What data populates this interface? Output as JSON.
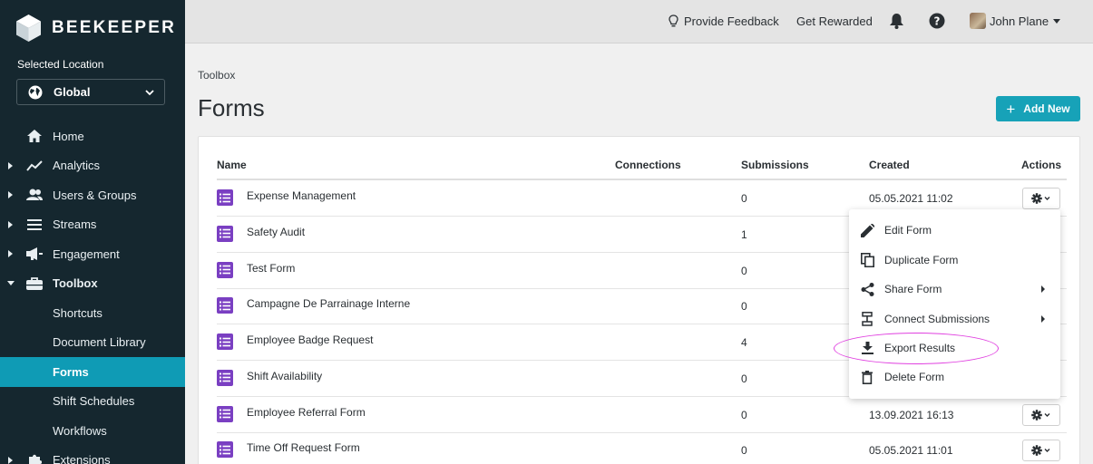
{
  "brand": {
    "name": "BEEKEEPER"
  },
  "location": {
    "label": "Selected Location",
    "value": "Global"
  },
  "nav": [
    {
      "label": "Home",
      "icon": "home-icon",
      "caret": false,
      "sub": false,
      "active": false
    },
    {
      "label": "Analytics",
      "icon": "analytics-icon",
      "caret": true,
      "sub": false,
      "active": false
    },
    {
      "label": "Users & Groups",
      "icon": "users-icon",
      "caret": true,
      "sub": false,
      "active": false
    },
    {
      "label": "Streams",
      "icon": "streams-icon",
      "caret": true,
      "sub": false,
      "active": false
    },
    {
      "label": "Engagement",
      "icon": "megaphone-icon",
      "caret": true,
      "sub": false,
      "active": false
    },
    {
      "label": "Toolbox",
      "icon": "toolbox-icon",
      "caret": "open",
      "sub": false,
      "active": false,
      "bold": true
    },
    {
      "label": "Shortcuts",
      "sub": true,
      "active": false
    },
    {
      "label": "Document Library",
      "sub": true,
      "active": false
    },
    {
      "label": "Forms",
      "sub": true,
      "active": true
    },
    {
      "label": "Shift Schedules",
      "sub": true,
      "active": false
    },
    {
      "label": "Workflows",
      "sub": true,
      "active": false
    },
    {
      "label": "Extensions",
      "icon": "puzzle-icon",
      "caret": true,
      "sub": false,
      "active": false
    }
  ],
  "topbar": {
    "feedback": "Provide Feedback",
    "rewarded": "Get Rewarded",
    "user": "John Plane"
  },
  "page": {
    "breadcrumb": "Toolbox",
    "title": "Forms",
    "add_label": "Add New"
  },
  "table": {
    "columns": [
      "Name",
      "Connections",
      "Submissions",
      "Created",
      "Actions"
    ],
    "rows": [
      {
        "name": "Expense Management",
        "submissions": "0",
        "created": "05.05.2021 11:02",
        "gear": true
      },
      {
        "name": "Safety Audit",
        "submissions": "1",
        "created": "",
        "gear": false
      },
      {
        "name": "Test Form",
        "submissions": "0",
        "created": "",
        "gear": false
      },
      {
        "name": "Campagne De Parrainage Interne",
        "submissions": "0",
        "created": "",
        "gear": false
      },
      {
        "name": "Employee Badge Request",
        "submissions": "4",
        "created": "",
        "gear": false
      },
      {
        "name": "Shift Availability",
        "submissions": "0",
        "created": "",
        "gear": false
      },
      {
        "name": "Employee Referral Form",
        "submissions": "0",
        "created": "13.09.2021 16:13",
        "gear": true
      },
      {
        "name": "Time Off Request Form",
        "submissions": "0",
        "created": "05.05.2021 11:01",
        "gear": true
      }
    ]
  },
  "menu": [
    {
      "label": "Edit Form",
      "icon": "pencil-icon",
      "submenu": false
    },
    {
      "label": "Duplicate Form",
      "icon": "copy-icon",
      "submenu": false
    },
    {
      "label": "Share Form",
      "icon": "share-icon",
      "submenu": true
    },
    {
      "label": "Connect Submissions",
      "icon": "connect-icon",
      "submenu": true
    },
    {
      "label": "Export Results",
      "icon": "download-icon",
      "submenu": false
    },
    {
      "label": "Delete Form",
      "icon": "trash-icon",
      "submenu": false
    }
  ],
  "colors": {
    "sidebar": "#15272f",
    "accent": "#17a2b8",
    "active_nav": "#0f9bb5",
    "form_icon": "#7a3fc2",
    "highlight": "#e040e0"
  }
}
